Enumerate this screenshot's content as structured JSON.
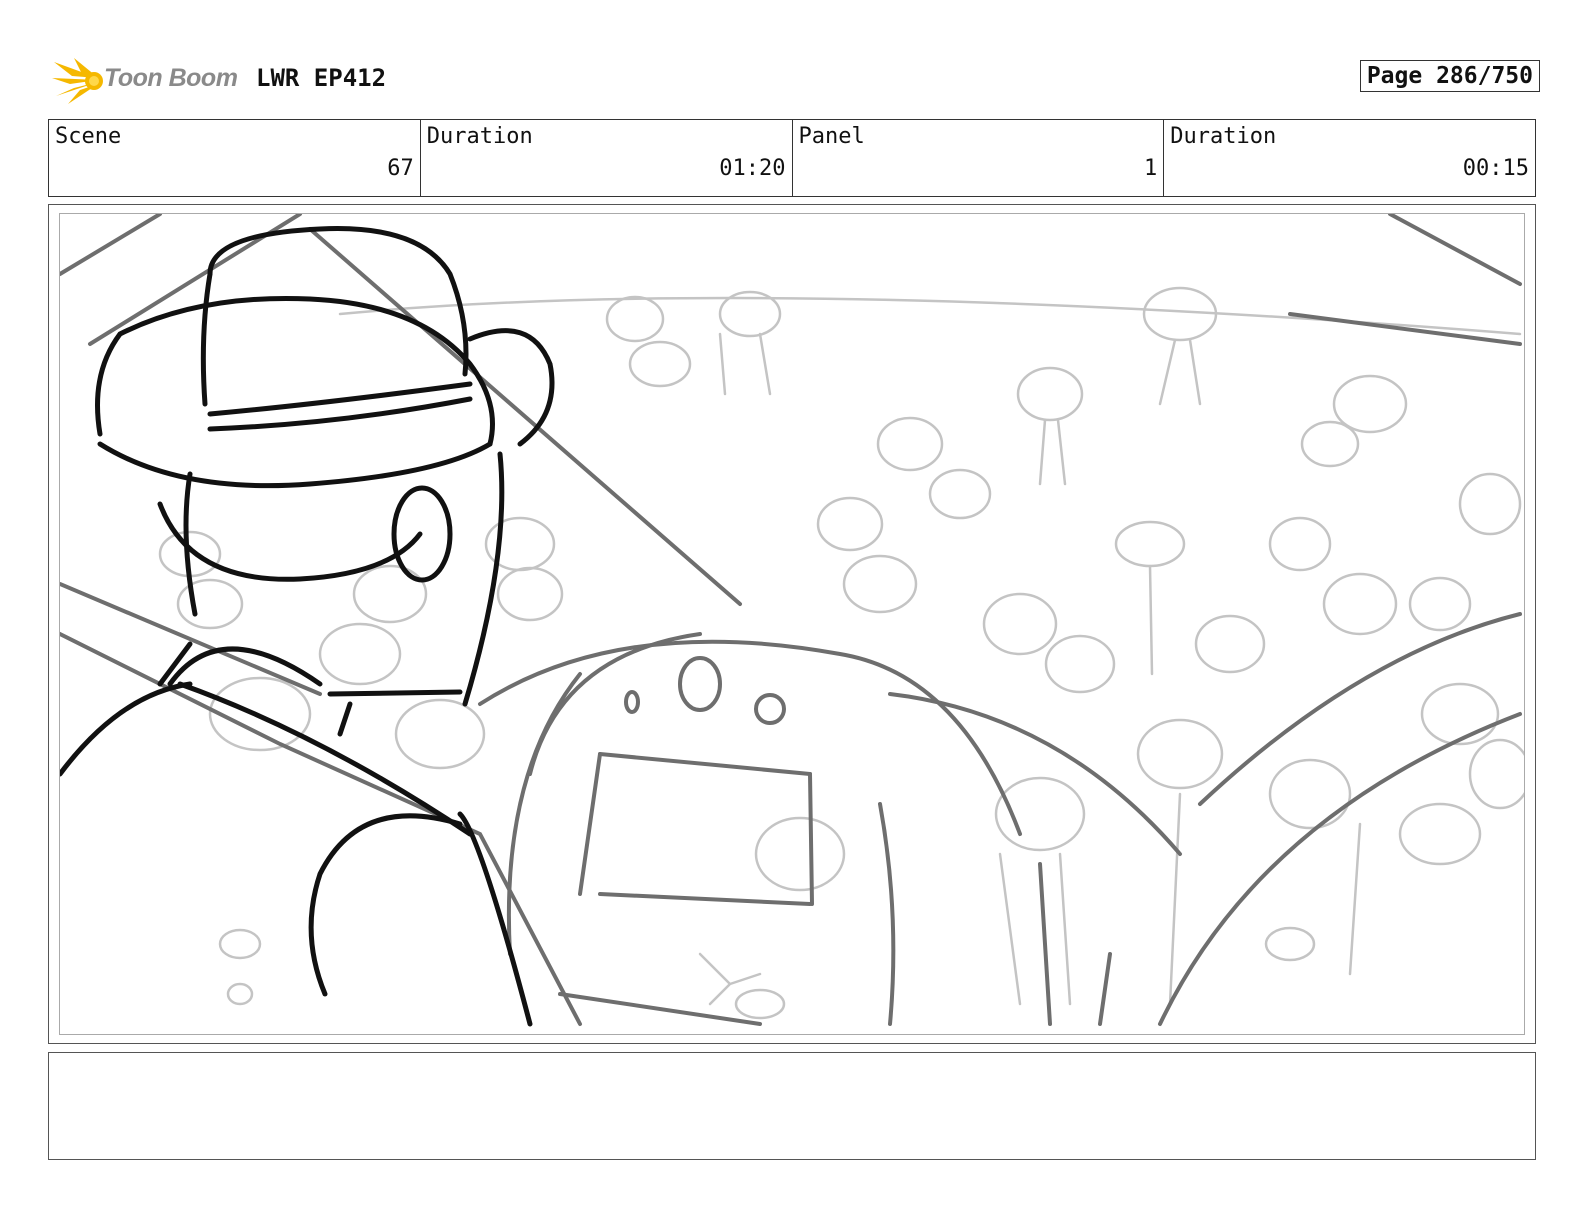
{
  "header": {
    "logo_text": "Toon Boom",
    "project": "LWR EP412",
    "page": "Page 286/750"
  },
  "info": {
    "scene_label": "Scene",
    "scene_value": "67",
    "scene_duration_label": "Duration",
    "scene_duration_value": "01:20",
    "panel_label": "Panel",
    "panel_value": "1",
    "panel_duration_label": "Duration",
    "panel_duration_value": "00:15"
  },
  "panel": {
    "image": "storyboard-sketch"
  },
  "notes": {
    "text": ""
  },
  "colors": {
    "logo_yellow": "#f5b800",
    "sketch_dark": "#111111",
    "sketch_mid": "#6e6e6e",
    "sketch_light": "#c4c4c4"
  }
}
